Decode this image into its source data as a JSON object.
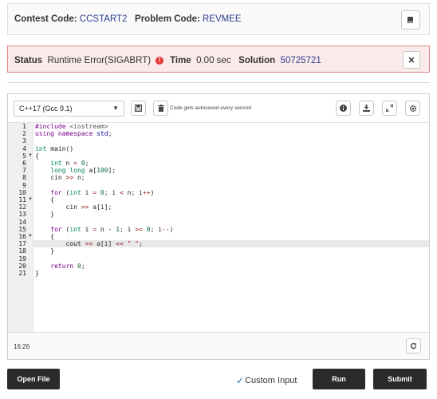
{
  "header": {
    "contest_label": "Contest Code:",
    "contest_value": "CCSTART2",
    "problem_label": "Problem Code:",
    "problem_value": "REVMEE",
    "book_icon": "book-icon"
  },
  "status": {
    "status_label": "Status",
    "status_value": "Runtime Error(SIGABRT)",
    "error_icon_glyph": "!",
    "time_label": "Time",
    "time_value": "0.00 sec",
    "solution_label": "Solution",
    "solution_value": "50725721",
    "close_glyph": "✕",
    "error_color": "#e53935"
  },
  "editor": {
    "language": "C++17 (Gcc 9.1)",
    "autosave_text": "Code gets autosaved every second",
    "icons": [
      "save-icon",
      "trash-icon",
      "info-icon",
      "download-icon",
      "expand-icon",
      "settings-icon"
    ],
    "lines": [
      "1",
      "2",
      "3",
      "4",
      "5",
      "6",
      "7",
      "8",
      "9",
      "10",
      "11",
      "12",
      "13",
      "14",
      "15",
      "16",
      "17",
      "18",
      "19",
      "20",
      "21"
    ],
    "active_line": "17",
    "cursor_position": "16:26",
    "refresh_icon": "refresh-icon"
  },
  "actions": {
    "open_file": "Open File",
    "custom_input": "Custom Input",
    "custom_input_checked": true,
    "run": "Run",
    "submit": "Submit"
  },
  "code_lines": [
    "#include <iostream>",
    "using namespace std;",
    "",
    "int main()",
    "{",
    "    int n = 0;",
    "    long long a[100];",
    "    cin >> n;",
    "",
    "    for (int i = 0; i < n; i++)",
    "    {",
    "        cin >> a[i];",
    "    }",
    "",
    "    for (int i = n - 1; i >= 0; i--)",
    "    {",
    "        cout << a[i] << \" \";",
    "    }",
    "",
    "    return 0;",
    "}"
  ]
}
